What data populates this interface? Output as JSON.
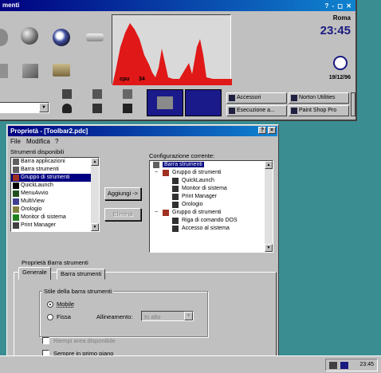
{
  "toolbar_window": {
    "title": "menti",
    "title_buttons": "? - ◻ ✕",
    "cpu_label": "cpu",
    "cpu_value": "34",
    "clock": {
      "city": "Roma",
      "time": "23:45",
      "date": "19/12/96"
    },
    "dock_buttons": [
      {
        "label": "Accessori"
      },
      {
        "label": "Norton Utilities"
      },
      {
        "label": "Esecuzione a..."
      },
      {
        "label": "Paint Shop Pro"
      }
    ]
  },
  "dialog": {
    "title": "Proprietà - [Toolbar2.pdc]",
    "help_btn": "?",
    "close_btn": "×",
    "menu": {
      "file": "File",
      "edit": "Modifica",
      "help": "?"
    },
    "available_label": "Strumenti disponibili",
    "available_tools": [
      {
        "label": "Barra applicazioni",
        "icon": "bar-icon",
        "selected": false
      },
      {
        "label": "Barra strumenti",
        "icon": "bar-icon",
        "selected": false
      },
      {
        "label": "Gruppo di strumenti",
        "icon": "group-icon",
        "selected": true
      },
      {
        "label": "QuickLaunch",
        "icon": "check-icon",
        "selected": false
      },
      {
        "label": "MenuAvvio",
        "icon": "start-icon",
        "selected": false
      },
      {
        "label": "MultiView",
        "icon": "view-icon",
        "selected": false
      },
      {
        "label": "Orologio",
        "icon": "clock-icon",
        "selected": false
      },
      {
        "label": "Monitor di sistema",
        "icon": "monitor-icon",
        "selected": false
      },
      {
        "label": "Print Manager",
        "icon": "printer-icon",
        "selected": false
      }
    ],
    "add_button": "Aggiungi ->",
    "remove_button": "Elimina",
    "current_label": "Configurazione corrente:",
    "current_tree": [
      {
        "label": "Barra strumenti",
        "level": 0,
        "selected": true,
        "toggle": ""
      },
      {
        "label": "Gruppo di strumenti",
        "level": 1,
        "selected": false,
        "toggle": "−"
      },
      {
        "label": "QuickLaunch",
        "level": 2,
        "selected": false,
        "toggle": ""
      },
      {
        "label": "Monitor di sistema",
        "level": 2,
        "selected": false,
        "toggle": ""
      },
      {
        "label": "Print Manager",
        "level": 2,
        "selected": false,
        "toggle": ""
      },
      {
        "label": "Orologio",
        "level": 2,
        "selected": false,
        "toggle": ""
      },
      {
        "label": "Gruppo di strumenti",
        "level": 1,
        "selected": false,
        "toggle": "−"
      },
      {
        "label": "Riga di comando DOS",
        "level": 2,
        "selected": false,
        "toggle": ""
      },
      {
        "label": "Accesso al sistema",
        "level": 2,
        "selected": false,
        "toggle": ""
      }
    ],
    "props_label": "Proprietà Barra strumenti",
    "tabs": [
      "Generale",
      "Barra strumenti"
    ],
    "style_group_label": "Stile della barra strumenti",
    "radio_mobile": "Mobile",
    "radio_fixed": "Fissa",
    "alignment_label": "Allineamento:",
    "alignment_value": "In alto",
    "check_1": "Riempi area disponibile",
    "check_2": "Sempre in primo piano"
  },
  "taskbar": {
    "time": "23:45"
  },
  "colors": {
    "desktop": "#3a8e92",
    "title_bar": "#000080",
    "window": "#c0c0c0",
    "cpu_graph": "#e01818"
  }
}
